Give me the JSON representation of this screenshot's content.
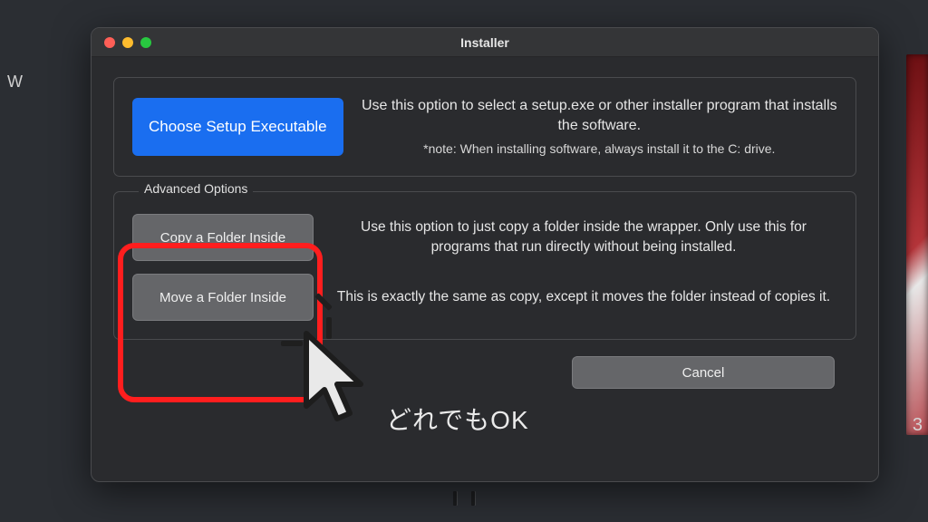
{
  "background": {
    "left_char": "W",
    "right_char": "3"
  },
  "window": {
    "title": "Installer",
    "top_panel": {
      "button_label": "Choose Setup Executable",
      "description": "Use this option to select a setup.exe or other installer program that installs the software.",
      "note": "*note: When installing software, always install it to the C: drive."
    },
    "advanced": {
      "legend": "Advanced Options",
      "copy_button": "Copy a Folder Inside",
      "copy_text": "Use this option to just copy a folder inside the wrapper. Only use this for programs that run directly without being installed.",
      "move_button": "Move a Folder Inside",
      "move_text": "This is exactly the same as copy, except it moves the folder instead of copies it."
    },
    "cancel_label": "Cancel"
  },
  "annotation": {
    "text": "どれでもOK"
  }
}
